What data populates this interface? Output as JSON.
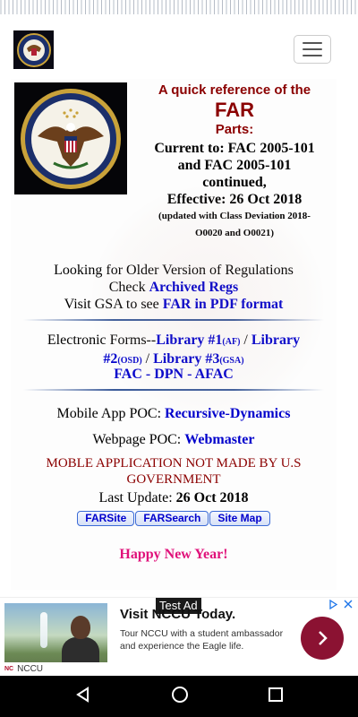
{
  "header": {
    "menu_icon": "hamburger-menu-icon",
    "logo_icon": "us-seal-icon"
  },
  "reference": {
    "line1": "A quick reference of the",
    "far": "FAR",
    "parts": "Parts:",
    "current_line1": "Current to: FAC 2005-101",
    "current_line2": "and FAC 2005-101",
    "current_line3": "continued,",
    "effective": "Effective: 26 Oct 2018",
    "updated_line1": "(updated with Class Deviation 2018-",
    "updated_line2": "O0020 and O0021)"
  },
  "older": {
    "line1": "Looking for Older Version of Regulations",
    "check_prefix": "Check ",
    "archived_link": "Archived Regs",
    "visit_prefix": "Visit GSA to see ",
    "pdf_link": "FAR in PDF format"
  },
  "forms": {
    "prefix": "Electronic Forms--",
    "lib1": "Library #1",
    "lib1_tag": "(AF)",
    "sep1": " / ",
    "lib2a": "Library",
    "lib2b": "#2",
    "lib2_tag": "(OSD)",
    "sep2": " / ",
    "lib3": "Library #3",
    "lib3_tag": "(GSA)",
    "fac": "FAC",
    "dpn": "DPN",
    "afac": "AFAC",
    "dash": " - "
  },
  "poc": {
    "mobile_label": "Mobile App POC: ",
    "mobile_link": "Recursive-Dynamics",
    "web_label": "Webpage POC: ",
    "web_link": "Webmaster"
  },
  "disclaimer": {
    "line1": "MOBLE APPLICATION NOT MADE BY U.S",
    "line2": "GOVERNMENT"
  },
  "last_update": {
    "label": "Last Update: ",
    "date": "26 Oct 2018"
  },
  "buttons": {
    "farsite": "FARSite",
    "farsearch": "FARSearch",
    "sitemap": "Site Map"
  },
  "greeting": "Happy New Year!",
  "ad": {
    "tag": "Test Ad",
    "title": "Visit NCCU Today.",
    "text": "Tour NCCU with a student ambassador and experience the Eagle life.",
    "brand": "NCCU",
    "brand_mark": "NC",
    "adchoices_icon": "adchoices-icon",
    "close_icon": "close-icon",
    "go_icon": "chevron-right-icon"
  },
  "navbar": {
    "back_icon": "back-triangle-icon",
    "home_icon": "home-circle-icon",
    "recents_icon": "recents-square-icon"
  },
  "colors": {
    "title_red": "#8b0000",
    "link_blue": "#0000cc",
    "greeting_pink": "#e0117a",
    "ad_button": "#8b1232"
  }
}
